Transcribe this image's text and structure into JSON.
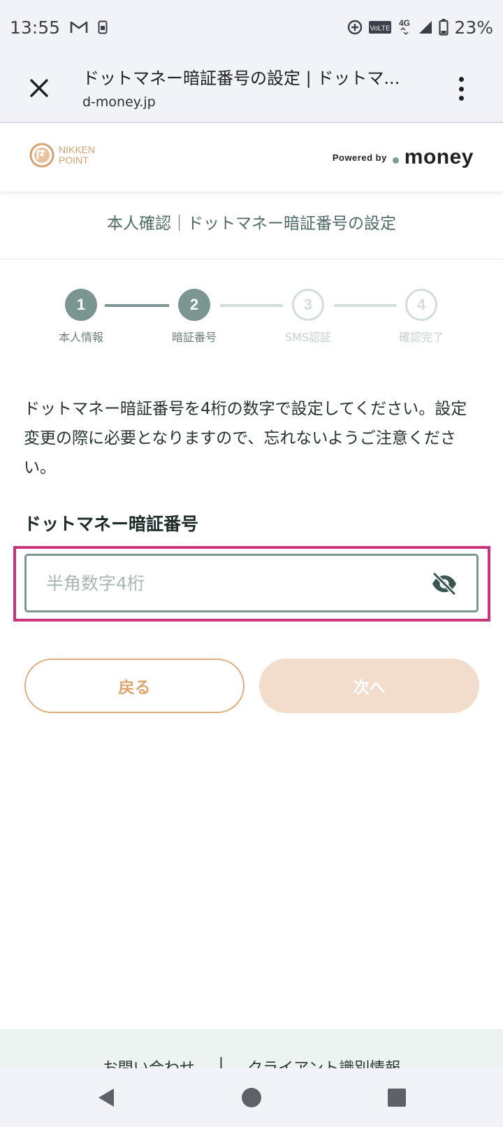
{
  "status_bar": {
    "time": "13:55",
    "network_label": "4G",
    "volte_label": "VoLTE",
    "battery": "23%"
  },
  "browser": {
    "title": "ドットマネー暗証番号の設定 | ドットマ...",
    "url": "d-money.jp"
  },
  "header": {
    "nikken_line1": "NIKKEN",
    "nikken_line2": "POINT",
    "powered_by": "Powered by",
    "money_logo": "money"
  },
  "section_heading": "本人確認｜ドットマネー暗証番号の設定",
  "stepper": {
    "steps": [
      {
        "number": "1",
        "label": "本人情報",
        "state": "active"
      },
      {
        "number": "2",
        "label": "暗証番号",
        "state": "active"
      },
      {
        "number": "3",
        "label": "SMS認証",
        "state": "inactive"
      },
      {
        "number": "4",
        "label": "確認完了",
        "state": "inactive"
      }
    ]
  },
  "description": "ドットマネー暗証番号を4桁の数字で設定してください。設定変更の際に必要となりますので、忘れないようご注意ください。",
  "pin_field": {
    "label": "ドットマネー暗証番号",
    "placeholder": "半角数字4桁",
    "value": "",
    "toggle_icon": "eye-off-icon"
  },
  "buttons": {
    "back_label": "戻る",
    "next_label": "次へ"
  },
  "footer": {
    "contact": "お問い合わせ",
    "separator": "|",
    "client_info": "クライアント識別情報"
  },
  "colors": {
    "accent": "#7b9590",
    "highlight": "#c9357a",
    "back_button": "#dda66c",
    "next_button_disabled": "#f2dccb"
  }
}
